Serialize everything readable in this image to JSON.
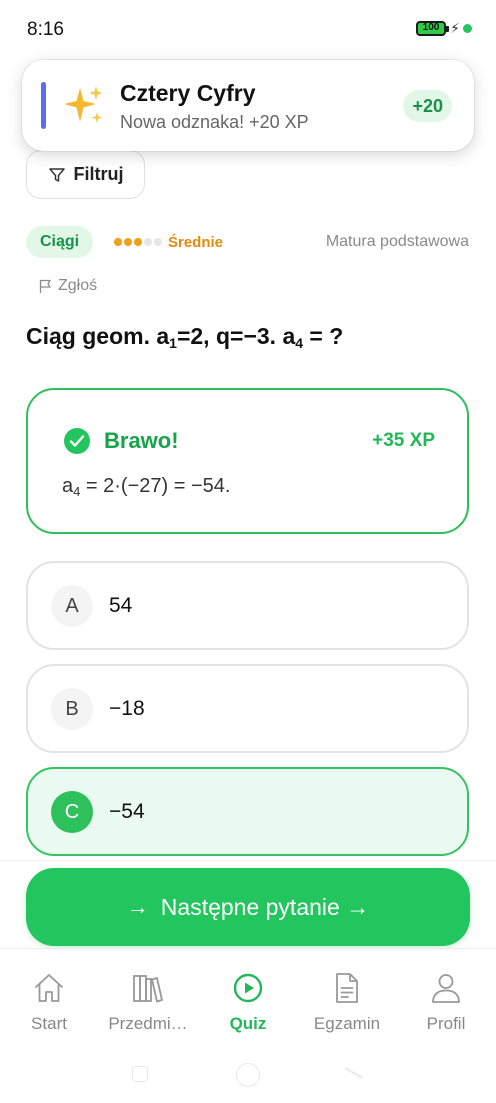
{
  "status": {
    "time": "8:16",
    "battery": "100"
  },
  "toast": {
    "title": "Cztery Cyfry",
    "subtitle": "Nowa odznaka! +20 XP",
    "badge": "+20",
    "icon": "sparkles-icon"
  },
  "filter": {
    "label": "Filtruj"
  },
  "question_meta": {
    "topic": "Ciągi",
    "difficulty_label": "Średnie",
    "difficulty_level": 3,
    "difficulty_max": 5,
    "level": "Matura podstawowa",
    "report_label": "Zgłoś"
  },
  "question": {
    "prefix": "Ciąg geom. a",
    "sub1": "1",
    "middle": "=2, q=−3. a",
    "sub2": "4",
    "suffix": " = ?"
  },
  "feedback": {
    "title": "Brawo!",
    "xp": "+35 XP",
    "text_prefix": "a",
    "text_sub": "4",
    "text_suffix": " = 2·(−27) = −54."
  },
  "options": [
    {
      "letter": "A",
      "text": "54",
      "state": "normal"
    },
    {
      "letter": "B",
      "text": "−18",
      "state": "normal"
    },
    {
      "letter": "C",
      "text": "−54",
      "state": "correct"
    }
  ],
  "next_button": {
    "label": "Następne pytanie →",
    "icon": "arrow-right-icon"
  },
  "tabs": [
    {
      "label": "Start",
      "icon": "home-icon",
      "active": false
    },
    {
      "label": "Przedmi…",
      "icon": "books-icon",
      "active": false
    },
    {
      "label": "Quiz",
      "icon": "play-circle-icon",
      "active": true
    },
    {
      "label": "Egzamin",
      "icon": "document-icon",
      "active": false
    },
    {
      "label": "Profil",
      "icon": "user-icon",
      "active": false
    }
  ],
  "colors": {
    "accent": "#22c55e",
    "accent_dark": "#17a34a",
    "warning": "#e38b0b",
    "toast_bar": "#5b6cf0"
  }
}
